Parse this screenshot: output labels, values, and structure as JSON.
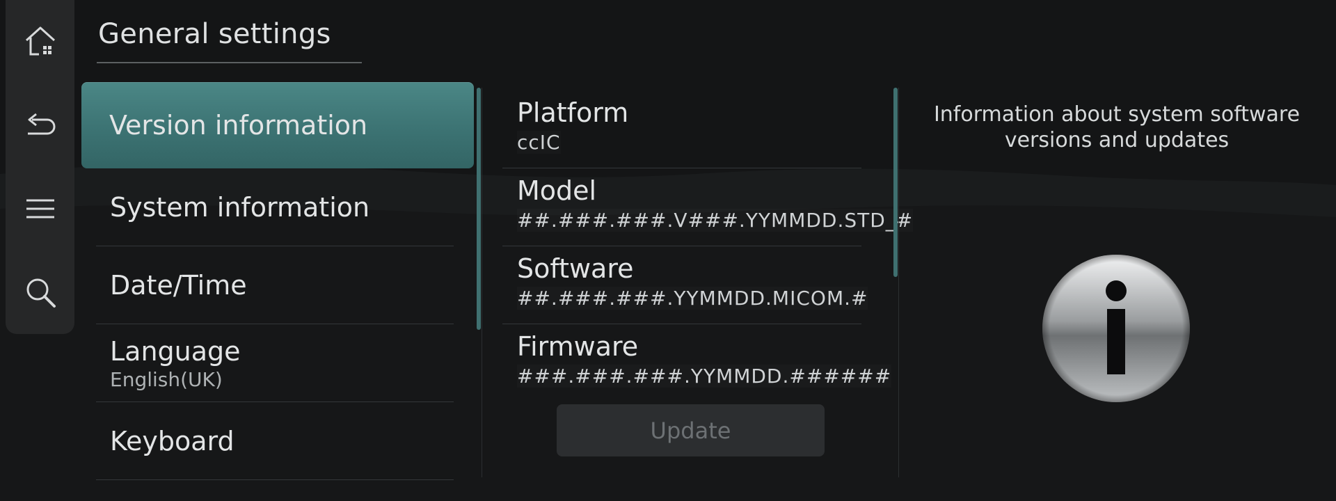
{
  "header": {
    "title": "General settings"
  },
  "rail": {
    "items": [
      {
        "icon": "home-icon"
      },
      {
        "icon": "back-icon"
      },
      {
        "icon": "menu-icon"
      },
      {
        "icon": "search-icon"
      }
    ]
  },
  "menu": {
    "items": [
      {
        "label": "Version information",
        "sub": "",
        "active": true
      },
      {
        "label": "System information",
        "sub": ""
      },
      {
        "label": "Date/Time",
        "sub": ""
      },
      {
        "label": "Language",
        "sub": "English(UK)"
      },
      {
        "label": "Keyboard",
        "sub": ""
      }
    ]
  },
  "info": {
    "items": [
      {
        "label": "Platform",
        "value": "ccIC"
      },
      {
        "label": "Model",
        "value": "##.###.###.V###.YYMMDD.STD_#"
      },
      {
        "label": "Software",
        "value": "##.###.###.YYMMDD.MICOM.#"
      },
      {
        "label": "Firmware",
        "value": "###.###.###.YYMMDD.######"
      }
    ],
    "update_label": "Update"
  },
  "description": {
    "text": "Information about system software versions and updates"
  },
  "colors": {
    "accent": "#3f7a79",
    "background": "#141516"
  }
}
